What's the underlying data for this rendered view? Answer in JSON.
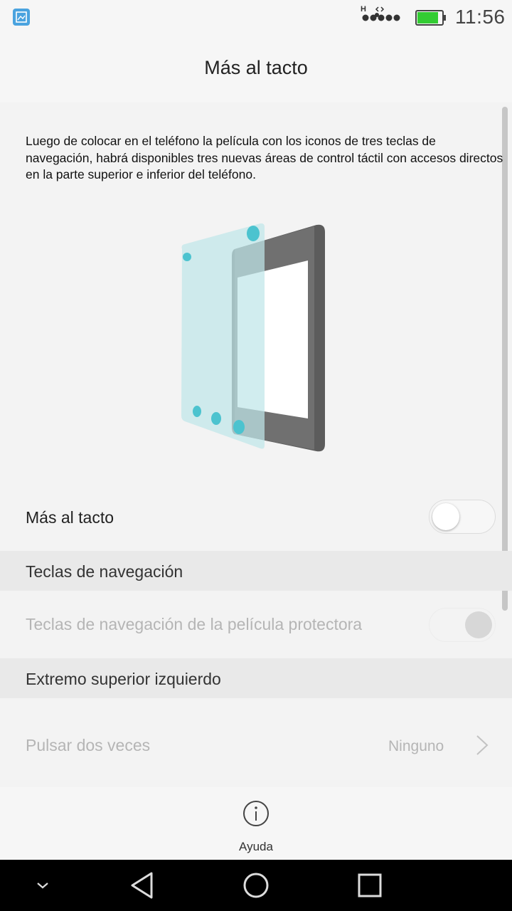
{
  "status_bar": {
    "time": "11:56",
    "network_type": "H",
    "battery_level": 0.85,
    "battery_color": "#33cc33",
    "icons": [
      "gallery-notification-icon",
      "signal-icon",
      "battery-icon"
    ]
  },
  "header": {
    "title": "Más al tacto"
  },
  "description": "Luego de colocar en el teléfono la película con los iconos de tres teclas de navegación, habrá disponibles tres nuevas áreas de control táctil con accesos directos en la parte superior e inferior del teléfono.",
  "settings": {
    "main_toggle": {
      "label": "Más al tacto",
      "enabled": false
    },
    "section_nav_keys": {
      "title": "Teclas de navegación"
    },
    "protective_film_keys": {
      "label": "Teclas de navegación de la película protectora",
      "enabled": false,
      "disabled": true
    },
    "section_top_left": {
      "title": "Extremo superior izquierdo"
    },
    "double_tap": {
      "label": "Pulsar dos veces",
      "value": "Ninguno",
      "disabled": true
    }
  },
  "help": {
    "label": "Ayuda"
  },
  "navigation_bar": {
    "buttons": [
      "collapse-icon",
      "back-icon",
      "home-icon",
      "recents-icon"
    ]
  },
  "colors": {
    "accent_teal": "#4cc3cf",
    "film_tint": "#bfe6e9",
    "device_body": "#6f6f6f",
    "section_bg": "#e9e9e9",
    "disabled_text": "#b5b5b5"
  }
}
